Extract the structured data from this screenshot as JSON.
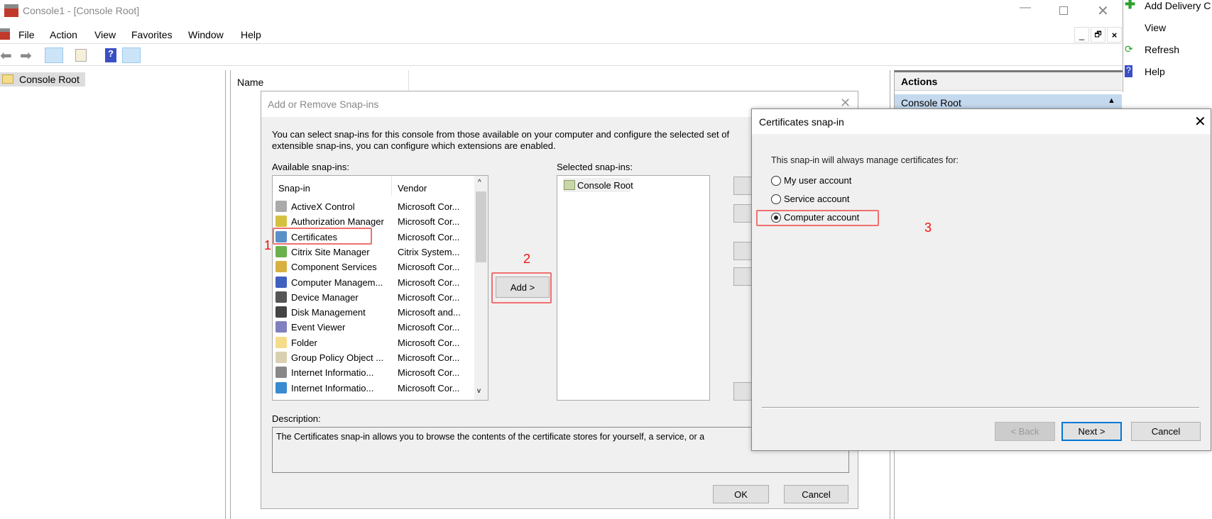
{
  "window": {
    "title": "Console1 - [Console Root]",
    "controls": [
      "minimize",
      "maximize",
      "close"
    ]
  },
  "menu": [
    "File",
    "Action",
    "View",
    "Favorites",
    "Window",
    "Help"
  ],
  "toolbar": {
    "icons": [
      "back-arrow-icon",
      "forward-arrow-icon",
      "show-hide-tree-icon",
      "export-list-icon",
      "help-icon",
      "show-hide-action-pane-icon"
    ]
  },
  "tree": {
    "root": "Console Root"
  },
  "main": {
    "column_name": "Name"
  },
  "actions": {
    "header": "Actions",
    "section": "Console Root",
    "overflow_items": [
      "Add Delivery C",
      "View",
      "Refresh",
      "Help"
    ]
  },
  "snapin_dialog": {
    "title": "Add or Remove Snap-ins",
    "intro_line1": "You can select snap-ins for this console from those available on your computer and configure the selected set of",
    "intro_line2": "extensible snap-ins, you can configure which extensions are enabled.",
    "available_label": "Available snap-ins:",
    "columns": [
      "Snap-in",
      "Vendor"
    ],
    "items": [
      {
        "name": "ActiveX Control",
        "vendor": "Microsoft Cor..."
      },
      {
        "name": "Authorization Manager",
        "vendor": "Microsoft Cor..."
      },
      {
        "name": "Certificates",
        "vendor": "Microsoft Cor..."
      },
      {
        "name": "Citrix Site Manager",
        "vendor": "Citrix System..."
      },
      {
        "name": "Component Services",
        "vendor": "Microsoft Cor..."
      },
      {
        "name": "Computer Managem...",
        "vendor": "Microsoft Cor..."
      },
      {
        "name": "Device Manager",
        "vendor": "Microsoft Cor..."
      },
      {
        "name": "Disk Management",
        "vendor": "Microsoft and..."
      },
      {
        "name": "Event Viewer",
        "vendor": "Microsoft Cor..."
      },
      {
        "name": "Folder",
        "vendor": "Microsoft Cor..."
      },
      {
        "name": "Group Policy Object ...",
        "vendor": "Microsoft Cor..."
      },
      {
        "name": "Internet Informatio...",
        "vendor": "Microsoft Cor..."
      },
      {
        "name": "Internet Informatio...",
        "vendor": "Microsoft Cor..."
      }
    ],
    "add_button": "Add >",
    "selected_label": "Selected snap-ins:",
    "selected_items": [
      "Console Root"
    ],
    "description_label": "Description:",
    "description": "The Certificates snap-in allows you to browse the contents of the certificate stores for yourself, a service, or a",
    "ok": "OK",
    "cancel": "Cancel"
  },
  "cert_dialog": {
    "title": "Certificates snap-in",
    "prompt": "This snap-in will always manage certificates for:",
    "options": [
      {
        "label": "My user account",
        "selected": false
      },
      {
        "label": "Service account",
        "selected": false
      },
      {
        "label": "Computer account",
        "selected": true
      }
    ],
    "back": "< Back",
    "next": "Next >",
    "cancel": "Cancel"
  },
  "annotations": [
    "1",
    "2",
    "3"
  ],
  "colors": {
    "annotation": "#f01010",
    "selection": "#c4d9ee",
    "dialog_bg": "#f0f0f0",
    "focus": "#0078d7"
  }
}
